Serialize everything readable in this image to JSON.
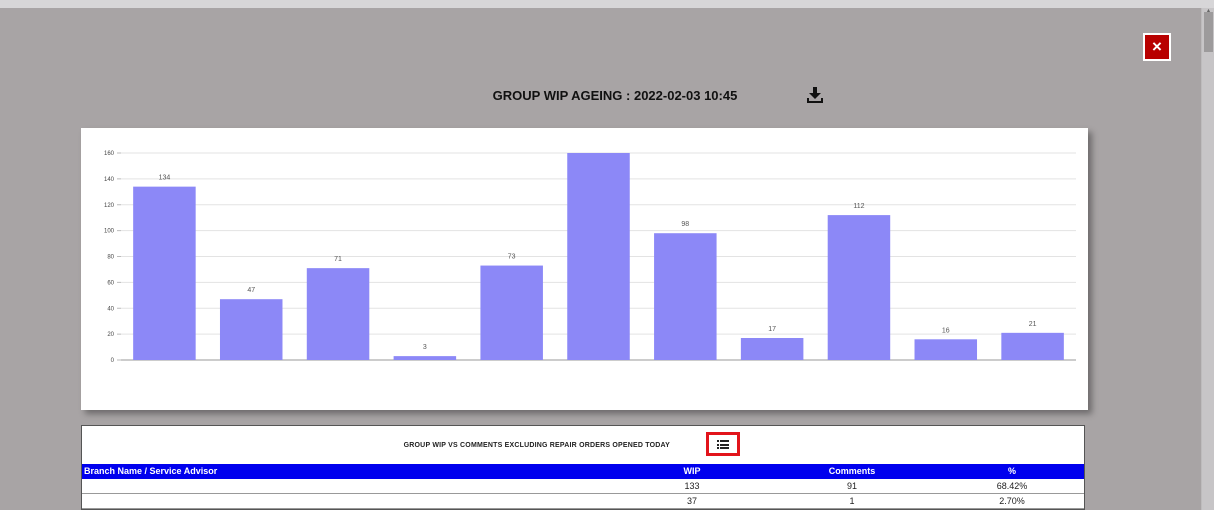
{
  "close_label": "×",
  "title": "GROUP WIP AGEING : 2022-02-03 10:45",
  "download_icon": "download-icon",
  "chart_data": {
    "type": "bar",
    "values": [
      134,
      47,
      71,
      3,
      73,
      160,
      98,
      17,
      112,
      16,
      21
    ],
    "data_labels": [
      "134",
      "47",
      "71",
      "3",
      "73",
      "",
      "98",
      "17",
      "112",
      "16",
      "21"
    ],
    "ylim": [
      0,
      160
    ],
    "yticks": [
      "0",
      "20",
      "40",
      "60",
      "80",
      "100",
      "120",
      "140",
      "160"
    ],
    "grid": true,
    "bar_color": "#8c88f7"
  },
  "table": {
    "title": "GROUP WIP VS COMMENTS EXCLUDING REPAIR ORDERS OPENED TODAY",
    "toggle_icon": "list-icon",
    "headers": [
      "Branch Name / Service Advisor",
      "WIP",
      "Comments",
      "%"
    ],
    "rows": [
      [
        "",
        "133",
        "91",
        "68.42%"
      ],
      [
        "",
        "37",
        "1",
        "2.70%"
      ]
    ]
  },
  "colors": {
    "overlay": "#a8a4a5",
    "close_button": "#b80000",
    "header_blue": "#0000ee",
    "toggle_border": "#e2141b"
  }
}
